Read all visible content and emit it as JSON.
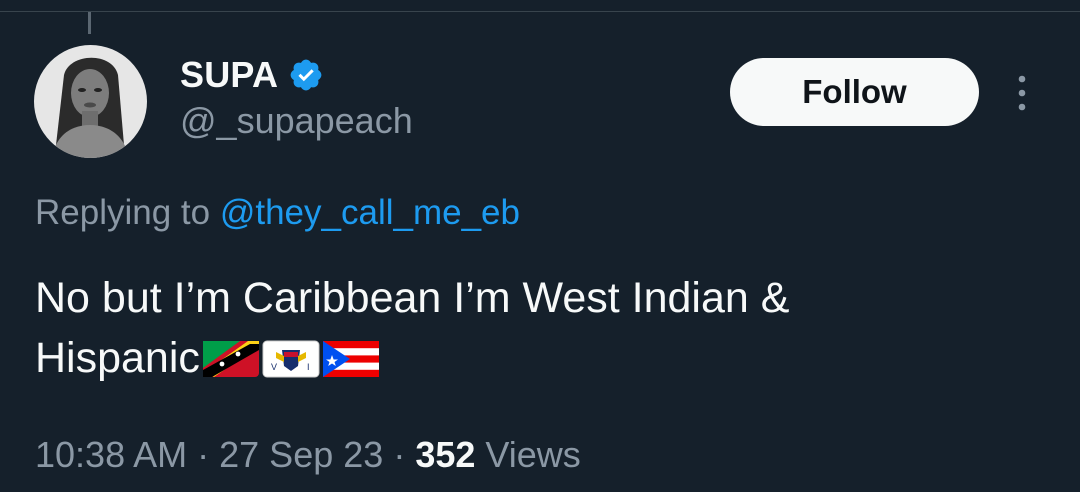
{
  "tweet": {
    "author": {
      "display_name": "SUPA",
      "handle": "@_supapeach",
      "verified": true
    },
    "follow_label": "Follow",
    "reply": {
      "prefix": "Replying to ",
      "mention": "@they_call_me_eb"
    },
    "text_line1": "No but I’m Caribbean I’m West Indian &",
    "text_line2": "Hispanic",
    "emojis": [
      "flag-saint-kitts-and-nevis",
      "flag-us-virgin-islands",
      "flag-puerto-rico"
    ],
    "time": "10:38 AM",
    "date": "27 Sep 23",
    "separator": "·",
    "views_count": "352",
    "views_label": "Views"
  },
  "colors": {
    "background": "#15202b",
    "text": "#f7f9f9",
    "secondary": "#8b98a5",
    "accent": "#1d9bf0"
  }
}
